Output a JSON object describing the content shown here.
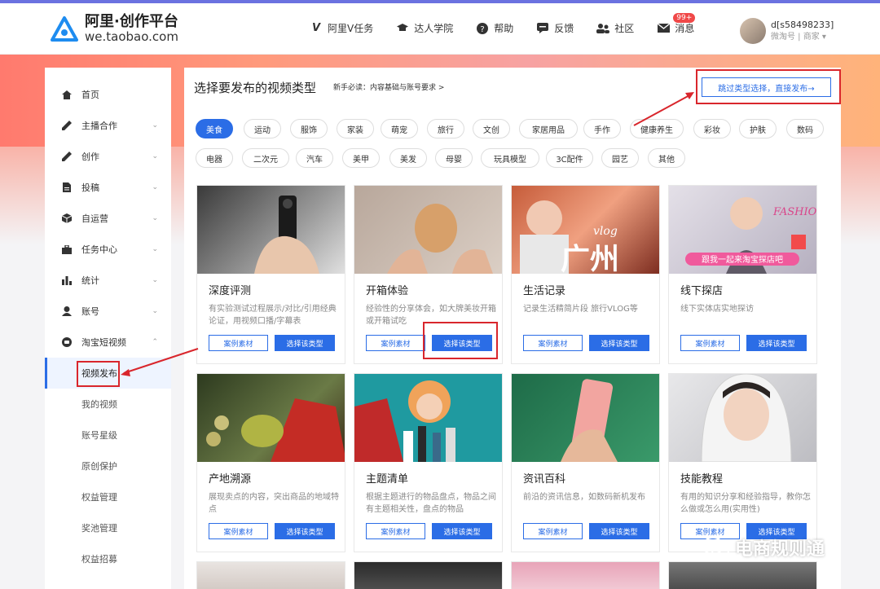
{
  "logo": {
    "name": "阿里·创作平台",
    "domain": "we.taobao.com"
  },
  "nav": [
    {
      "icon": "v-icon",
      "label": "阿里V任务"
    },
    {
      "icon": "graduation-cap-icon",
      "label": "达人学院"
    },
    {
      "icon": "help-icon",
      "label": "帮助"
    },
    {
      "icon": "feedback-icon",
      "label": "反馈"
    },
    {
      "icon": "community-icon",
      "label": "社区"
    },
    {
      "icon": "mail-icon",
      "label": "消息",
      "badge": "99+"
    }
  ],
  "user": {
    "name": "d[s58498233]",
    "role": "微淘号 | 商家"
  },
  "sidebar": {
    "items": [
      {
        "icon": "home-icon",
        "label": "首页",
        "chev": ""
      },
      {
        "icon": "pen-icon",
        "label": "主播合作",
        "chev": "⌄"
      },
      {
        "icon": "pen-icon",
        "label": "创作",
        "chev": "⌄"
      },
      {
        "icon": "document-icon",
        "label": "投稿",
        "chev": "⌄"
      },
      {
        "icon": "box-icon",
        "label": "自运营",
        "chev": "⌄"
      },
      {
        "icon": "briefcase-icon",
        "label": "任务中心",
        "chev": "⌄"
      },
      {
        "icon": "bar-chart-icon",
        "label": "统计",
        "chev": "⌄"
      },
      {
        "icon": "user-icon",
        "label": "账号",
        "chev": "⌄"
      },
      {
        "icon": "video-icon",
        "label": "淘宝短视频",
        "chev": "⌃"
      }
    ],
    "sub": [
      "视频发布",
      "我的视频",
      "账号星级",
      "原创保护",
      "权益管理",
      "奖池管理",
      "权益招募"
    ]
  },
  "main": {
    "title": "选择要发布的视频类型",
    "hint": "新手必读：内容基础与账号要求 >",
    "skip": "跳过类型选择，直接发布→",
    "cats_row1": [
      "美食",
      "运动",
      "服饰",
      "家装",
      "萌宠",
      "旅行",
      "文创",
      "家居用品",
      "手作",
      "健康养生",
      "彩妆",
      "护肤",
      "数码"
    ],
    "cats_row2": [
      "电器",
      "二次元",
      "汽车",
      "美甲",
      "美发",
      "母婴",
      "玩具模型",
      "3C配件",
      "园艺",
      "其他"
    ],
    "case_label": "案例素材",
    "choose_label": "选择该类型",
    "cards": [
      {
        "title": "深度评测",
        "desc": "有实验测试过程展示/对比/引用经典论证，用视频口播/字幕表"
      },
      {
        "title": "开箱体验",
        "desc": "经验性的分享体会，如大牌美妆开箱或开箱试吃"
      },
      {
        "title": "生活记录",
        "desc": "记录生活精简片段 旅行VLOG等"
      },
      {
        "title": "线下探店",
        "desc": "线下实体店实地探访"
      },
      {
        "title": "产地溯源",
        "desc": "展现卖点的内容，突出商品的地域特点"
      },
      {
        "title": "主题清单",
        "desc": "根据主题进行的物品盘点，物品之间有主题相关性，盘点的物品"
      },
      {
        "title": "资讯百科",
        "desc": "前沿的资讯信息，如数码新机发布"
      },
      {
        "title": "技能教程",
        "desc": "有用的知识分享和经验指导，教你怎么做或怎么用(实用性)"
      }
    ],
    "image_overlay_text": [
      "vlog",
      "广州",
      "FASHION",
      "跟我一起来淘宝探店吧"
    ]
  },
  "watermark": "电商规则通",
  "colors": {
    "accent": "#2b6de6",
    "highlight": "#d9262c",
    "badge": "#f04848"
  }
}
